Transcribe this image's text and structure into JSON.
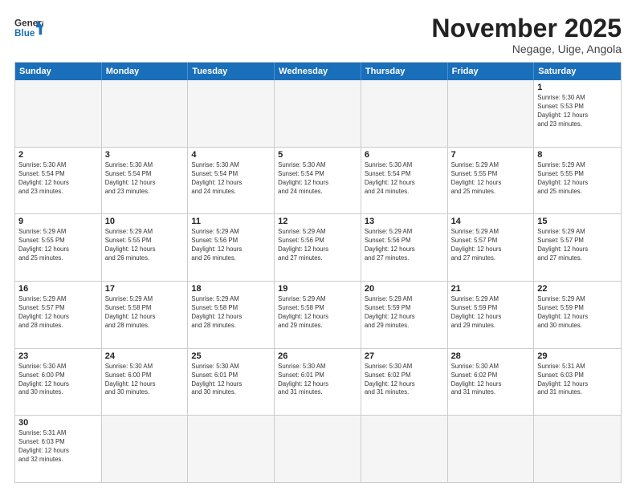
{
  "logo": {
    "text_general": "General",
    "text_blue": "Blue"
  },
  "header": {
    "month": "November 2025",
    "location": "Negage, Uige, Angola"
  },
  "weekdays": [
    "Sunday",
    "Monday",
    "Tuesday",
    "Wednesday",
    "Thursday",
    "Friday",
    "Saturday"
  ],
  "rows": [
    [
      {
        "day": "",
        "info": "",
        "empty": true
      },
      {
        "day": "",
        "info": "",
        "empty": true
      },
      {
        "day": "",
        "info": "",
        "empty": true
      },
      {
        "day": "",
        "info": "",
        "empty": true
      },
      {
        "day": "",
        "info": "",
        "empty": true
      },
      {
        "day": "",
        "info": "",
        "empty": true
      },
      {
        "day": "1",
        "info": "Sunrise: 5:30 AM\nSunset: 5:53 PM\nDaylight: 12 hours\nand 23 minutes."
      }
    ],
    [
      {
        "day": "2",
        "info": "Sunrise: 5:30 AM\nSunset: 5:54 PM\nDaylight: 12 hours\nand 23 minutes."
      },
      {
        "day": "3",
        "info": "Sunrise: 5:30 AM\nSunset: 5:54 PM\nDaylight: 12 hours\nand 23 minutes."
      },
      {
        "day": "4",
        "info": "Sunrise: 5:30 AM\nSunset: 5:54 PM\nDaylight: 12 hours\nand 24 minutes."
      },
      {
        "day": "5",
        "info": "Sunrise: 5:30 AM\nSunset: 5:54 PM\nDaylight: 12 hours\nand 24 minutes."
      },
      {
        "day": "6",
        "info": "Sunrise: 5:30 AM\nSunset: 5:54 PM\nDaylight: 12 hours\nand 24 minutes."
      },
      {
        "day": "7",
        "info": "Sunrise: 5:29 AM\nSunset: 5:55 PM\nDaylight: 12 hours\nand 25 minutes."
      },
      {
        "day": "8",
        "info": "Sunrise: 5:29 AM\nSunset: 5:55 PM\nDaylight: 12 hours\nand 25 minutes."
      }
    ],
    [
      {
        "day": "9",
        "info": "Sunrise: 5:29 AM\nSunset: 5:55 PM\nDaylight: 12 hours\nand 25 minutes."
      },
      {
        "day": "10",
        "info": "Sunrise: 5:29 AM\nSunset: 5:55 PM\nDaylight: 12 hours\nand 26 minutes."
      },
      {
        "day": "11",
        "info": "Sunrise: 5:29 AM\nSunset: 5:56 PM\nDaylight: 12 hours\nand 26 minutes."
      },
      {
        "day": "12",
        "info": "Sunrise: 5:29 AM\nSunset: 5:56 PM\nDaylight: 12 hours\nand 27 minutes."
      },
      {
        "day": "13",
        "info": "Sunrise: 5:29 AM\nSunset: 5:56 PM\nDaylight: 12 hours\nand 27 minutes."
      },
      {
        "day": "14",
        "info": "Sunrise: 5:29 AM\nSunset: 5:57 PM\nDaylight: 12 hours\nand 27 minutes."
      },
      {
        "day": "15",
        "info": "Sunrise: 5:29 AM\nSunset: 5:57 PM\nDaylight: 12 hours\nand 27 minutes."
      }
    ],
    [
      {
        "day": "16",
        "info": "Sunrise: 5:29 AM\nSunset: 5:57 PM\nDaylight: 12 hours\nand 28 minutes."
      },
      {
        "day": "17",
        "info": "Sunrise: 5:29 AM\nSunset: 5:58 PM\nDaylight: 12 hours\nand 28 minutes."
      },
      {
        "day": "18",
        "info": "Sunrise: 5:29 AM\nSunset: 5:58 PM\nDaylight: 12 hours\nand 28 minutes."
      },
      {
        "day": "19",
        "info": "Sunrise: 5:29 AM\nSunset: 5:58 PM\nDaylight: 12 hours\nand 29 minutes."
      },
      {
        "day": "20",
        "info": "Sunrise: 5:29 AM\nSunset: 5:59 PM\nDaylight: 12 hours\nand 29 minutes."
      },
      {
        "day": "21",
        "info": "Sunrise: 5:29 AM\nSunset: 5:59 PM\nDaylight: 12 hours\nand 29 minutes."
      },
      {
        "day": "22",
        "info": "Sunrise: 5:29 AM\nSunset: 5:59 PM\nDaylight: 12 hours\nand 30 minutes."
      }
    ],
    [
      {
        "day": "23",
        "info": "Sunrise: 5:30 AM\nSunset: 6:00 PM\nDaylight: 12 hours\nand 30 minutes."
      },
      {
        "day": "24",
        "info": "Sunrise: 5:30 AM\nSunset: 6:00 PM\nDaylight: 12 hours\nand 30 minutes."
      },
      {
        "day": "25",
        "info": "Sunrise: 5:30 AM\nSunset: 6:01 PM\nDaylight: 12 hours\nand 30 minutes."
      },
      {
        "day": "26",
        "info": "Sunrise: 5:30 AM\nSunset: 6:01 PM\nDaylight: 12 hours\nand 31 minutes."
      },
      {
        "day": "27",
        "info": "Sunrise: 5:30 AM\nSunset: 6:02 PM\nDaylight: 12 hours\nand 31 minutes."
      },
      {
        "day": "28",
        "info": "Sunrise: 5:30 AM\nSunset: 6:02 PM\nDaylight: 12 hours\nand 31 minutes."
      },
      {
        "day": "29",
        "info": "Sunrise: 5:31 AM\nSunset: 6:03 PM\nDaylight: 12 hours\nand 31 minutes."
      }
    ],
    [
      {
        "day": "30",
        "info": "Sunrise: 5:31 AM\nSunset: 6:03 PM\nDaylight: 12 hours\nand 32 minutes."
      },
      {
        "day": "",
        "info": "",
        "empty": true
      },
      {
        "day": "",
        "info": "",
        "empty": true
      },
      {
        "day": "",
        "info": "",
        "empty": true
      },
      {
        "day": "",
        "info": "",
        "empty": true
      },
      {
        "day": "",
        "info": "",
        "empty": true
      },
      {
        "day": "",
        "info": "",
        "empty": true
      }
    ]
  ]
}
